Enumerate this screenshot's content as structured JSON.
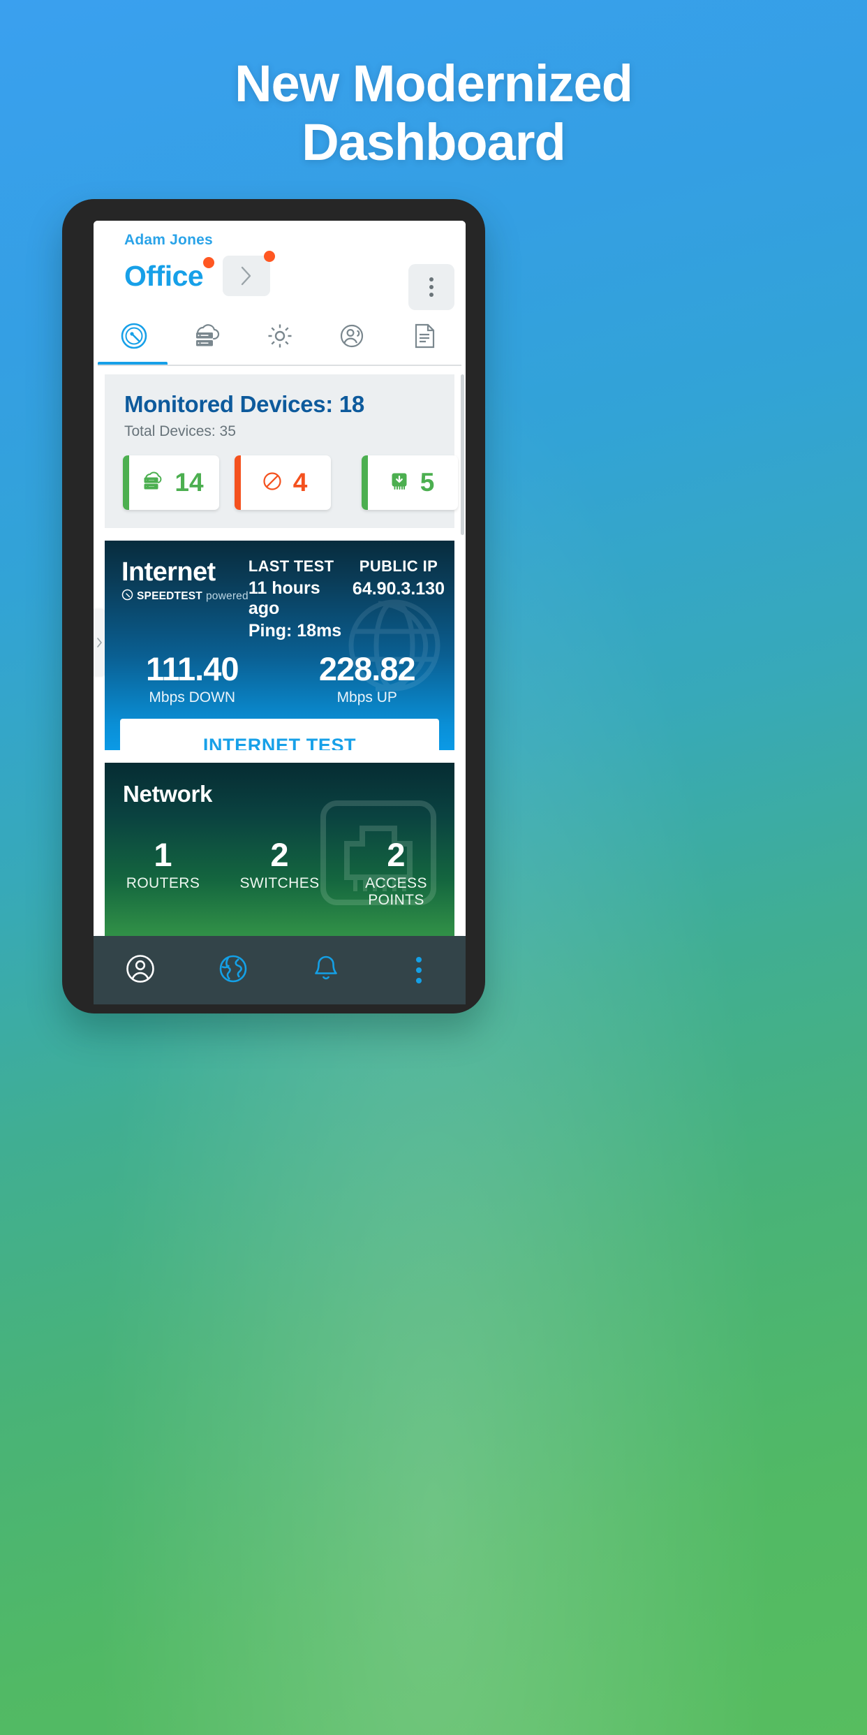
{
  "promo": {
    "headline_line1": "New Modernized",
    "headline_line2": "Dashboard",
    "bg_top_color": "#3aa0ef",
    "bg_bottom_color": "#57bd5f"
  },
  "app": {
    "header": {
      "user_name": "Adam Jones",
      "site_name": "Office",
      "site_badge_color": "#ff5722",
      "next_site_icon": "chevron-right-icon",
      "overflow_icon": "kebab-menu-icon",
      "accent_color": "#17a0e8"
    },
    "tabs": [
      {
        "icon": "speedometer-icon",
        "name": "dashboard",
        "active": true
      },
      {
        "icon": "cloud-server-icon",
        "name": "devices",
        "active": false
      },
      {
        "icon": "gear-icon",
        "name": "settings",
        "active": false
      },
      {
        "icon": "users-icon",
        "name": "clients",
        "active": false
      },
      {
        "icon": "document-icon",
        "name": "reports",
        "active": false
      }
    ],
    "monitored_devices_card": {
      "title": "Monitored Devices: 18",
      "subtitle": "Total Devices: 35",
      "chips": [
        {
          "icon": "cloud-server-icon",
          "value": "14",
          "color": "#4caf50",
          "state": "up"
        },
        {
          "icon": "blocked-icon",
          "value": "4",
          "color": "#f4511e",
          "state": "down"
        },
        {
          "icon": "firmware-download-icon",
          "value": "5",
          "color": "#4caf50",
          "state": "update-available"
        }
      ]
    },
    "internet_card": {
      "title": "Internet",
      "powered_by_bold": "SPEEDTEST",
      "powered_by_light": "powered",
      "powered_icon": "speedtest-gauge-icon",
      "last_test_label": "LAST TEST",
      "last_test_value": "11 hours ago",
      "ping_value": "Ping:  18ms",
      "public_ip_label": "PUBLIC IP",
      "public_ip_value": "64.90.3.130",
      "download_value": "111.40",
      "download_label": "Mbps DOWN",
      "upload_value": "228.82",
      "upload_label": "Mbps UP",
      "test_button": "INTERNET TEST",
      "background_icon": "globe-icon"
    },
    "network_card": {
      "title": "Network",
      "background_icon": "ethernet-jack-icon",
      "stats": [
        {
          "value": "1",
          "label": "ROUTERS"
        },
        {
          "value": "2",
          "label": "SWITCHES"
        },
        {
          "value": "2",
          "label": "ACCESS POINTS"
        }
      ]
    },
    "bottom_nav": [
      {
        "icon": "account-circle-icon",
        "name": "account",
        "color": "#ffffff"
      },
      {
        "icon": "globe-icon",
        "name": "network-globe",
        "color": "#14a0e6"
      },
      {
        "icon": "bell-icon",
        "name": "notifications",
        "color": "#14a0e6"
      },
      {
        "icon": "kebab-menu-icon",
        "name": "more",
        "color": "#14a0e6"
      }
    ]
  }
}
